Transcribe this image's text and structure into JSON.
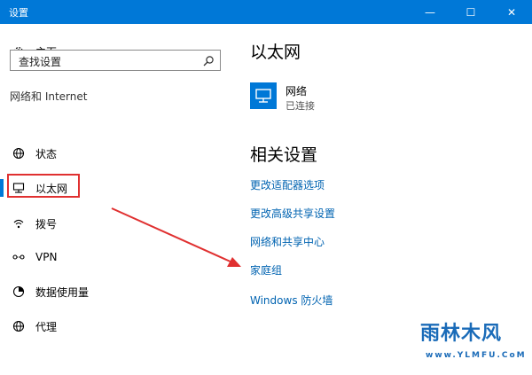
{
  "window": {
    "title": "设置",
    "minimize_glyph": "—",
    "maximize_glyph": "☐",
    "close_glyph": "✕",
    "accent": "#0078d7"
  },
  "sidebar": {
    "home_label": "主页",
    "search_placeholder": "查找设置",
    "section_label": "网络和 Internet",
    "items": [
      {
        "label": "状态",
        "icon": "globe-status-icon"
      },
      {
        "label": "以太网",
        "icon": "ethernet-icon",
        "selected": true
      },
      {
        "label": "拨号",
        "icon": "dialup-icon"
      },
      {
        "label": "VPN",
        "icon": "vpn-icon"
      },
      {
        "label": "数据使用量",
        "icon": "data-usage-icon"
      },
      {
        "label": "代理",
        "icon": "proxy-globe-icon"
      }
    ]
  },
  "main": {
    "heading": "以太网",
    "network": {
      "name": "网络",
      "status": "已连接"
    },
    "related_heading": "相关设置",
    "links": [
      "更改适配器选项",
      "更改高级共享设置",
      "网络和共享中心",
      "家庭组",
      "Windows 防火墙"
    ]
  },
  "annotation": {
    "arrow_color": "#e03030"
  },
  "watermark": {
    "text": "雨林木风",
    "url": "www.YLMFU.CoM"
  }
}
